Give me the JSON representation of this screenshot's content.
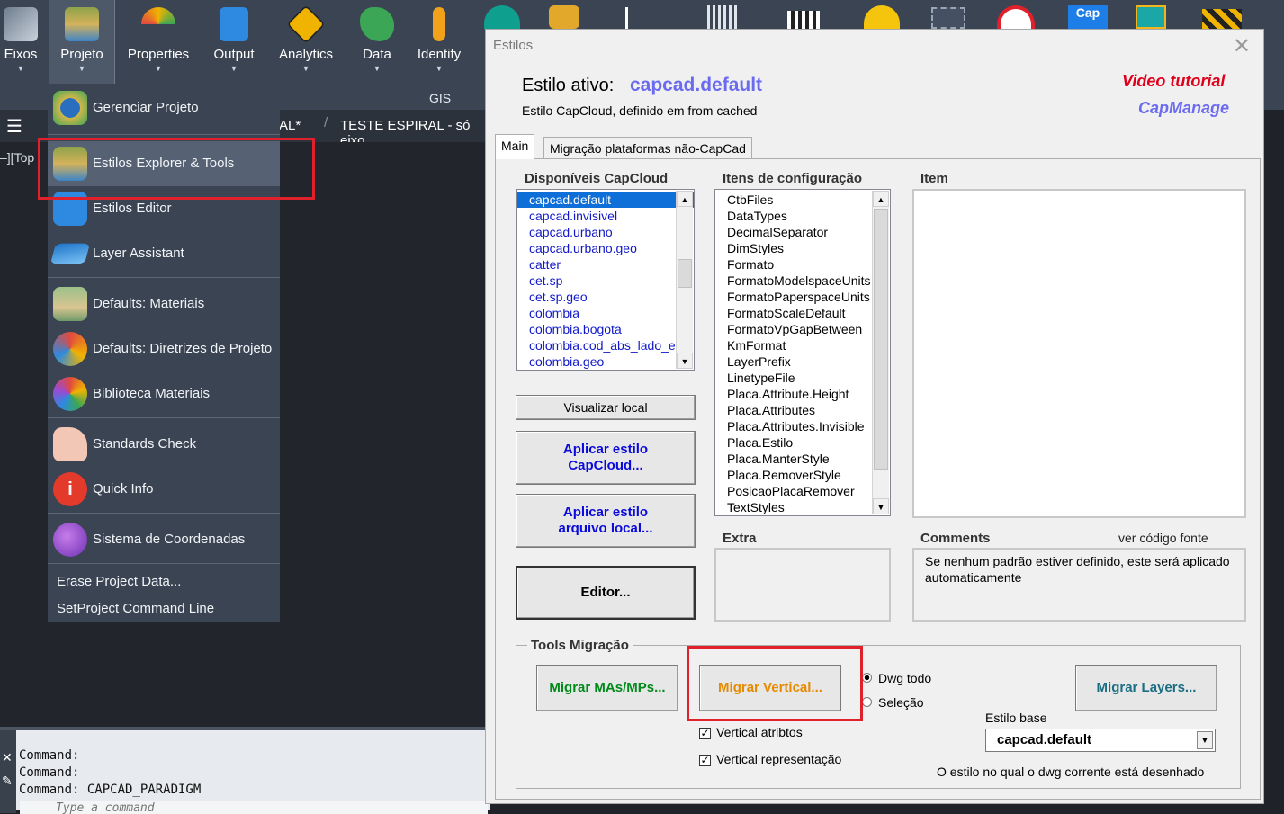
{
  "ribbon": {
    "items": [
      {
        "label": "Eixos",
        "icon": "road-icon",
        "color": "#6e7c8c"
      },
      {
        "label": "Projeto",
        "icon": "project-tools-icon",
        "color": "#8da24a"
      },
      {
        "label": "Properties",
        "icon": "gauge-icon",
        "color": "#e04a3f"
      },
      {
        "label": "Output",
        "icon": "checklist-icon",
        "color": "#2d8ae0"
      },
      {
        "label": "Analytics",
        "icon": "warning-sign-icon",
        "color": "#f0b400"
      },
      {
        "label": "Data",
        "icon": "brazil-map-icon",
        "color": "#3aa656"
      },
      {
        "label": "Identify",
        "icon": "person-icon",
        "color": "#f1a21a"
      }
    ],
    "group_label": "GIS"
  },
  "doc_tabs": {
    "tab1": "AL*",
    "tab2": "TESTE ESPIRAL - só eixo"
  },
  "canvas_label": "–][Top",
  "command": {
    "lines": [
      "Command:",
      "Command:",
      "Command:  CAPCAD_PARADIGM"
    ],
    "placeholder": "Type a command"
  },
  "menu": {
    "items": [
      {
        "label": "Gerenciar Projeto",
        "icon": "road-shield-icon"
      },
      {
        "label": "Estilos Explorer & Tools",
        "icon": "style-tools-icon"
      },
      {
        "label": "Estilos Editor",
        "icon": "monitor-edit-icon"
      },
      {
        "label": "Layer Assistant",
        "icon": "layers-icon"
      },
      {
        "label": "Defaults: Materiais",
        "icon": "materials-icon"
      },
      {
        "label": "Defaults: Diretrizes de Projeto",
        "icon": "guidelines-icon"
      },
      {
        "label": "Biblioteca Materiais",
        "icon": "color-wheel-icon"
      },
      {
        "label": "Standards Check",
        "icon": "thumbs-up-icon"
      },
      {
        "label": "Quick Info",
        "icon": "info-icon"
      },
      {
        "label": "Sistema de Coordenadas",
        "icon": "globe-pin-icon"
      }
    ],
    "text_items": [
      "Erase Project Data...",
      "SetProject Command Line"
    ]
  },
  "dialog": {
    "title": "Estilos",
    "active_label": "Estilo ativo:",
    "active_value": "capcad.default",
    "subtitle": "Estilo CapCloud, definido em from cached",
    "link_video": "Video tutorial",
    "link_manage": "CapManage",
    "tabs": [
      "Main",
      "Migração plataformas não-CapCad"
    ],
    "available_header": "Disponíveis CapCloud",
    "available": [
      "capcad.default",
      "capcad.invisivel",
      "capcad.urbano",
      "capcad.urbano.geo",
      "catter",
      "cet.sp",
      "cet.sp.geo",
      "colombia",
      "colombia.bogota",
      "colombia.cod_abs_lado_e",
      "colombia.geo"
    ],
    "config_header": "Itens de configuração",
    "config": [
      "CtbFiles",
      "DataTypes",
      "DecimalSeparator",
      "DimStyles",
      "Formato",
      "FormatoModelspaceUnits",
      "FormatoPaperspaceUnits",
      "FormatoScaleDefault",
      "FormatoVpGapBetween",
      "KmFormat",
      "LayerPrefix",
      "LinetypeFile",
      "Placa.Attribute.Height",
      "Placa.Attributes",
      "Placa.Attributes.Invisible",
      "Placa.Estilo",
      "Placa.ManterStyle",
      "Placa.RemoverStyle",
      "PosicaoPlacaRemover",
      "TextStyles"
    ],
    "item_header": "Item",
    "extra_header": "Extra",
    "comments_header": "Comments",
    "source_link": "ver código fonte",
    "comments_text": "Se nenhum padrão estiver definido, este será aplicado automaticamente",
    "btn_visualizar": "Visualizar local",
    "btn_aplicar_cloud": "Aplicar estilo CapCloud...",
    "btn_aplicar_local": "Aplicar estilo arquivo local...",
    "btn_editor": "Editor...",
    "tools_label": "Tools Migração",
    "btn_migrar_mas": "Migrar MAs/MPs...",
    "btn_migrar_vertical": "Migrar Vertical...",
    "btn_migrar_layers": "Migrar Layers...",
    "radio_dwg": "Dwg todo",
    "radio_sel": "Seleção",
    "chk_atributos": "Vertical atribtos",
    "chk_representacao": "Vertical representação",
    "estilo_base_label": "Estilo base",
    "estilo_base_value": "capcad.default",
    "footer_note": "O estilo no qual o dwg corrente está desenhado",
    "colors": {
      "accent_blue": "#6b6bef",
      "red": "#e0001b",
      "green": "#008a1a",
      "orange": "#e68a00",
      "teal": "#1b6e82",
      "btn_blue": "#0a0adc"
    }
  }
}
